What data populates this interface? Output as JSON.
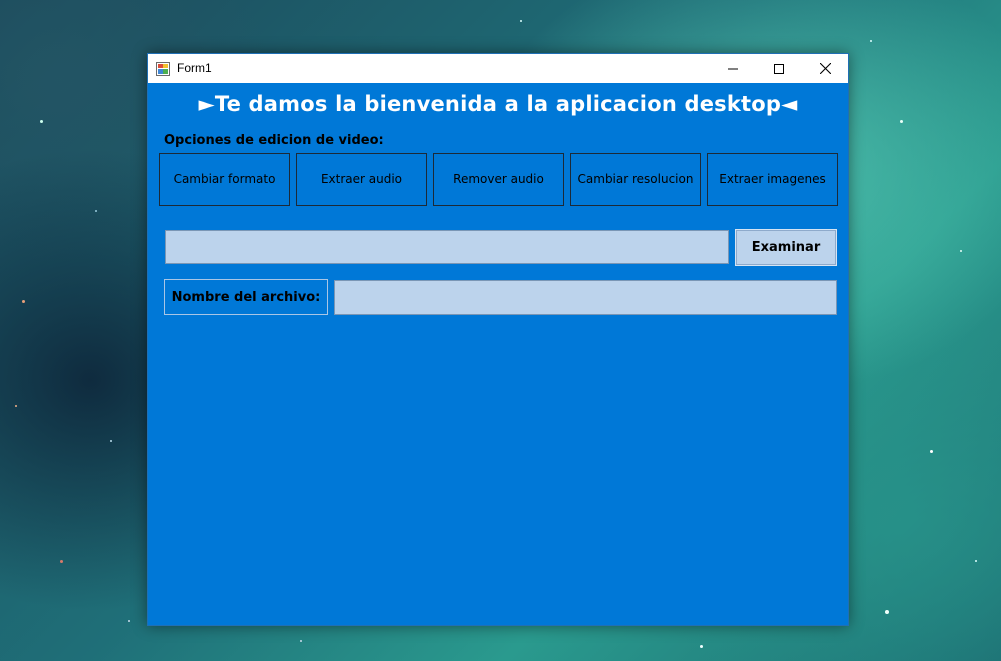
{
  "window": {
    "title": "Form1"
  },
  "header": {
    "welcome": "►Te damos la bienvenida a la aplicacion desktop◄"
  },
  "options": {
    "label": "Opciones de edicion de video:",
    "buttons": [
      {
        "label": "Cambiar formato"
      },
      {
        "label": "Extraer audio"
      },
      {
        "label": "Remover audio"
      },
      {
        "label": "Cambiar resolucion"
      },
      {
        "label": "Extraer imagenes"
      }
    ]
  },
  "file": {
    "path_value": "",
    "browse_label": "Examinar",
    "name_label": "Nombre del archivo:",
    "name_value": ""
  },
  "colors": {
    "form_background": "#0078d7",
    "input_background": "#bcd3ec"
  }
}
